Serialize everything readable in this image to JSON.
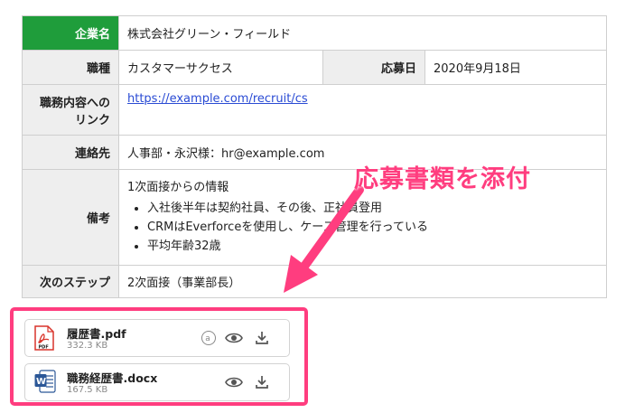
{
  "table": {
    "company_label": "企業名",
    "company_value": "株式会社グリーン・フィールド",
    "job_label": "職種",
    "job_value": "カスタマーサクセス",
    "apply_date_label": "応募日",
    "apply_date_value": "2020年9月18日",
    "job_link_label_line1": "職務内容への",
    "job_link_label_line2": "リンク",
    "job_link_value": "https://example.com/recruit/cs",
    "contact_label": "連絡先",
    "contact_value": "人事部・永沢様：hr@example.com",
    "notes_label": "備考",
    "notes_intro": "1次面接からの情報",
    "notes_items": [
      "入社後半年は契約社員、その後、正社員登用",
      "CRMはEverforceを使用し、ケース管理を行っている",
      "平均年齢32歳"
    ],
    "next_step_label": "次のステップ",
    "next_step_value": "2次面接（事業部長）"
  },
  "annotation": {
    "callout_text": "応募書類を添付",
    "colors": {
      "accent": "#ff3d7f",
      "header_green": "#1f9d3b"
    }
  },
  "attachments": [
    {
      "name": "履歴書.pdf",
      "size": "332.3 KB",
      "icon": "pdf-file-icon"
    },
    {
      "name": "職務経歴書.docx",
      "size": "167.5 KB",
      "icon": "word-file-icon"
    }
  ]
}
